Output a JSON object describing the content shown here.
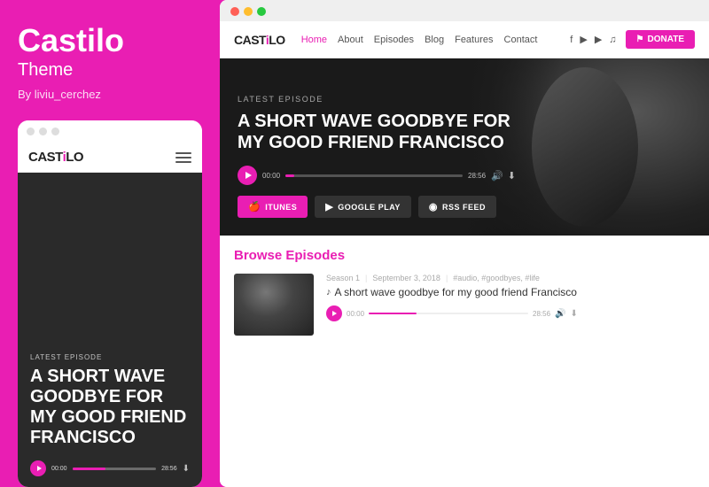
{
  "leftPanel": {
    "brandTitle": "Castilo",
    "brandSubtitle": "Theme",
    "brandBy": "By liviu_cerchez",
    "mobile": {
      "dots": [
        "dot1",
        "dot2",
        "dot3"
      ],
      "logo": "CAST",
      "logoAccent": "i",
      "logoSuffix": "LO",
      "heroLabel": "LATEST EPISODE",
      "heroTitle": "A SHORT WAVE GOODBYE FOR MY GOOD FRIEND FRANCISCO",
      "timeStart": "00:00",
      "timeEnd": "28:56"
    }
  },
  "rightPanel": {
    "browser": {
      "dots": [
        "close",
        "minimize",
        "maximize"
      ]
    },
    "nav": {
      "logo": "CAST",
      "logoAccent": "i",
      "logoSuffix": "LO",
      "links": [
        {
          "label": "Home",
          "active": true
        },
        {
          "label": "About",
          "active": false
        },
        {
          "label": "Episodes",
          "active": false
        },
        {
          "label": "Blog",
          "active": false
        },
        {
          "label": "Features",
          "active": false
        },
        {
          "label": "Contact",
          "active": false
        }
      ],
      "donateLabel": "DONATE"
    },
    "hero": {
      "latestLabel": "LATEST EPISODE",
      "title": "A SHORT WAVE GOODBYE FOR MY GOOD FRIEND FRANCISCO",
      "timeStart": "00:00",
      "timeEnd": "28:56",
      "subscribeButtons": [
        {
          "label": "ITUNES",
          "type": "itunes"
        },
        {
          "label": "GOOGLE PLAY",
          "type": "gplay"
        },
        {
          "label": "RSS FEED",
          "type": "rss"
        }
      ]
    },
    "browse": {
      "title": "Browse",
      "titleAccent": "Episodes",
      "episode": {
        "season": "Season 1",
        "date": "September 3, 2018",
        "tags": "#audio, #goodbyes, #life",
        "title": "A short wave goodbye for my good friend Francisco",
        "timeStart": "00:00",
        "timeEnd": "28:56"
      }
    }
  }
}
